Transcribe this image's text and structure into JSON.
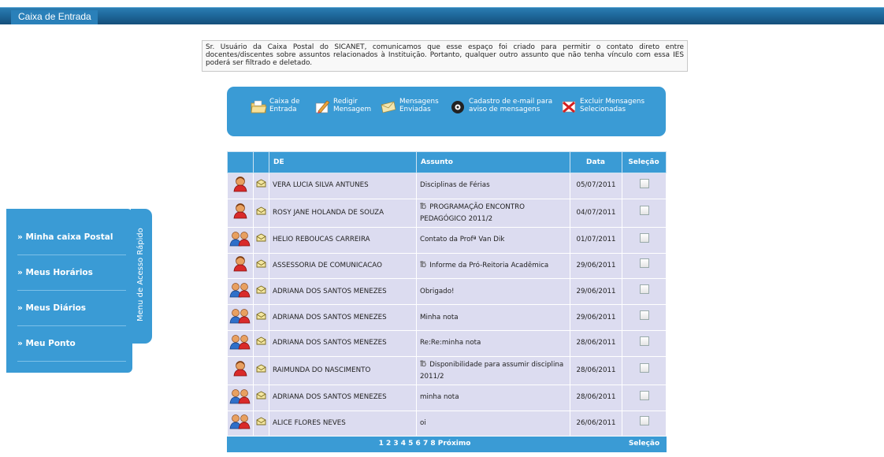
{
  "header": {
    "title": "Caixa de Entrada"
  },
  "notice": {
    "text": "Sr. Usuário da Caixa Postal do SICANET, comunicamos que esse espaço foi criado para permitir o contato direto entre docentes/discentes sobre assuntos relacionados à Instituição. Portanto, qualquer outro assunto que não tenha vínculo com essa IES poderá ser filtrado e deletado."
  },
  "menu": {
    "items": [
      {
        "label": "Caixa de\nEntrada",
        "icon": "folder-icon"
      },
      {
        "label": "Redigir\nMensagem",
        "icon": "compose-icon"
      },
      {
        "label": "Mensagens\nEnviadas",
        "icon": "sent-icon"
      },
      {
        "label": "Cadastro de e-mail para\naviso de mensagens",
        "icon": "email-register-icon"
      },
      {
        "label": "Excluir Mensagens\nSelecionadas",
        "icon": "delete-icon"
      }
    ]
  },
  "table": {
    "headers": {
      "from": "DE",
      "subject": "Assunto",
      "date": "Data",
      "select": "Seleção"
    },
    "rows": [
      {
        "sender_icon": "single-user-icon",
        "from": "VERA LUCIA SILVA ANTUNES",
        "subject": "Disciplinas de Férias",
        "attachment": false,
        "date": "05/07/2011"
      },
      {
        "sender_icon": "single-user-icon",
        "from": "ROSY JANE HOLANDA DE SOUZA",
        "subject": "PROGRAMAÇÃO ENCONTRO PEDAGÓGICO 2011/2",
        "attachment": true,
        "date": "04/07/2011"
      },
      {
        "sender_icon": "group-user-icon",
        "from": "HELIO REBOUCAS CARREIRA",
        "subject": "Contato da Profª Van Dik",
        "attachment": false,
        "date": "01/07/2011"
      },
      {
        "sender_icon": "single-user-icon",
        "from": "ASSESSORIA DE COMUNICACAO",
        "subject": "Informe da Pró-Reitoria Acadêmica",
        "attachment": true,
        "date": "29/06/2011"
      },
      {
        "sender_icon": "group-user-icon",
        "from": "ADRIANA DOS SANTOS MENEZES",
        "subject": "Obrigado!",
        "attachment": false,
        "date": "29/06/2011"
      },
      {
        "sender_icon": "group-user-icon",
        "from": "ADRIANA DOS SANTOS MENEZES",
        "subject": "Minha nota",
        "attachment": false,
        "date": "29/06/2011"
      },
      {
        "sender_icon": "group-user-icon",
        "from": "ADRIANA DOS SANTOS MENEZES",
        "subject": "Re:Re:minha nota",
        "attachment": false,
        "date": "28/06/2011"
      },
      {
        "sender_icon": "single-user-icon",
        "from": "RAIMUNDA DO NASCIMENTO",
        "subject": "Disponibilidade para assumir disciplina 2011/2",
        "attachment": true,
        "date": "28/06/2011"
      },
      {
        "sender_icon": "group-user-icon",
        "from": "ADRIANA DOS SANTOS MENEZES",
        "subject": "minha nota",
        "attachment": false,
        "date": "28/06/2011"
      },
      {
        "sender_icon": "group-user-icon",
        "from": "ALICE FLORES NEVES",
        "subject": "oi",
        "attachment": false,
        "date": "26/06/2011"
      }
    ],
    "footer": {
      "pages": "1 2 3 4 5 6 7 8 Próximo",
      "select": "Seleção"
    }
  },
  "side_menu": {
    "tab_label": "Menu de Acesso Rápido",
    "items": [
      {
        "label": "» Minha caixa Postal"
      },
      {
        "label": "» Meus Horários"
      },
      {
        "label": "» Meus Diários"
      },
      {
        "label": "» Meu Ponto"
      }
    ]
  },
  "colors": {
    "accent": "#3a9bd5",
    "header": "#1f6a9e",
    "row_bg": "#dcdcf0"
  }
}
